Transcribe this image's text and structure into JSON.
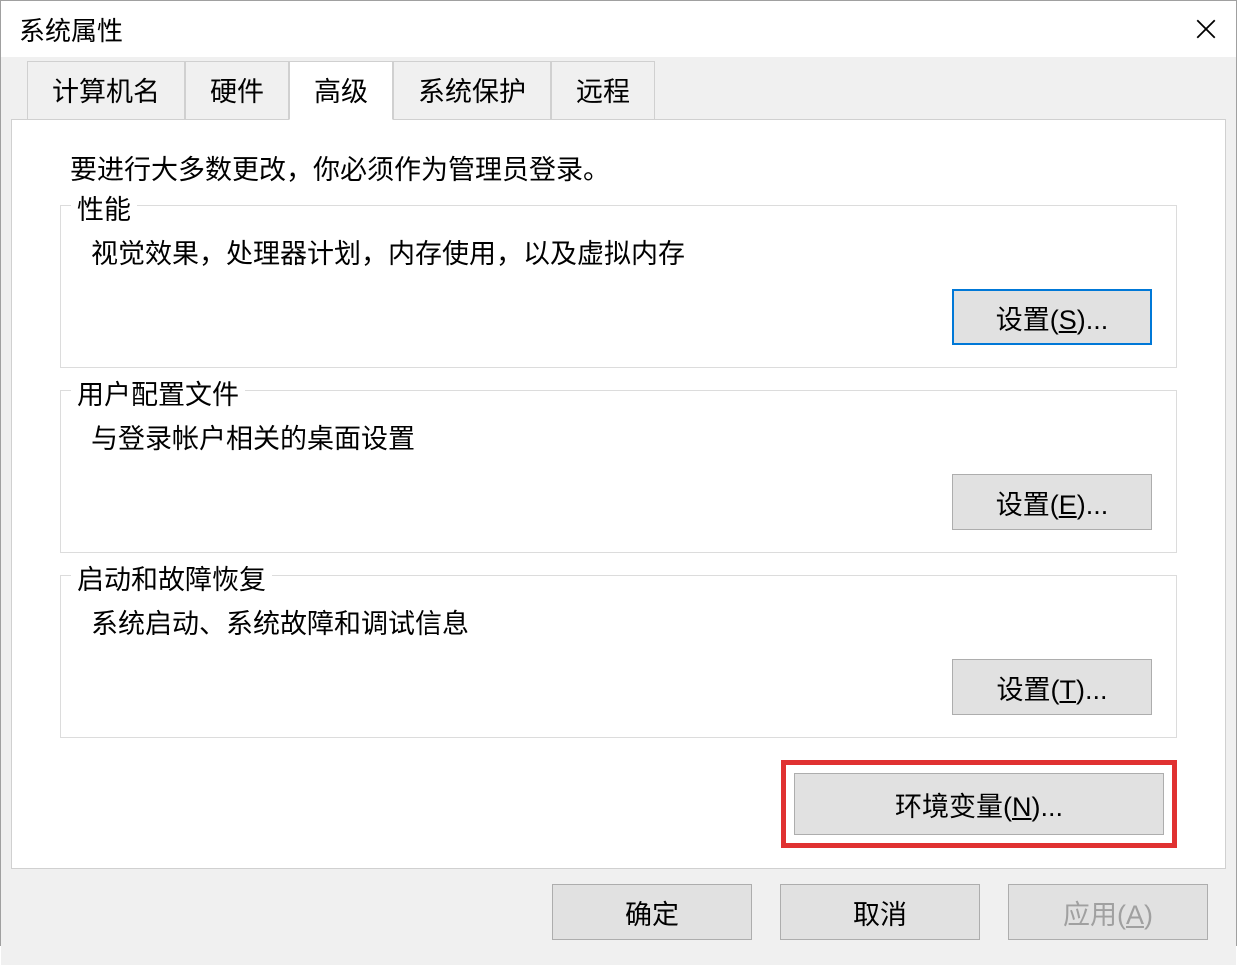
{
  "window": {
    "title": "系统属性"
  },
  "tabs": [
    {
      "label": "计算机名",
      "active": false
    },
    {
      "label": "硬件",
      "active": false
    },
    {
      "label": "高级",
      "active": true
    },
    {
      "label": "系统保护",
      "active": false
    },
    {
      "label": "远程",
      "active": false
    }
  ],
  "panel": {
    "intro": "要进行大多数更改，你必须作为管理员登录。",
    "groups": {
      "performance": {
        "legend": "性能",
        "desc": "视觉效果，处理器计划，内存使用，以及虚拟内存",
        "button_prefix": "设置(",
        "button_m": "S",
        "button_suffix": ")..."
      },
      "profiles": {
        "legend": "用户配置文件",
        "desc": "与登录帐户相关的桌面设置",
        "button_prefix": "设置(",
        "button_m": "E",
        "button_suffix": ")..."
      },
      "startup": {
        "legend": "启动和故障恢复",
        "desc": "系统启动、系统故障和调试信息",
        "button_prefix": "设置(",
        "button_m": "T",
        "button_suffix": ")..."
      }
    },
    "env_button_prefix": "环境变量(",
    "env_button_m": "N",
    "env_button_suffix": ")..."
  },
  "footer": {
    "ok": "确定",
    "cancel": "取消",
    "apply_prefix": "应用(",
    "apply_m": "A",
    "apply_suffix": ")"
  }
}
